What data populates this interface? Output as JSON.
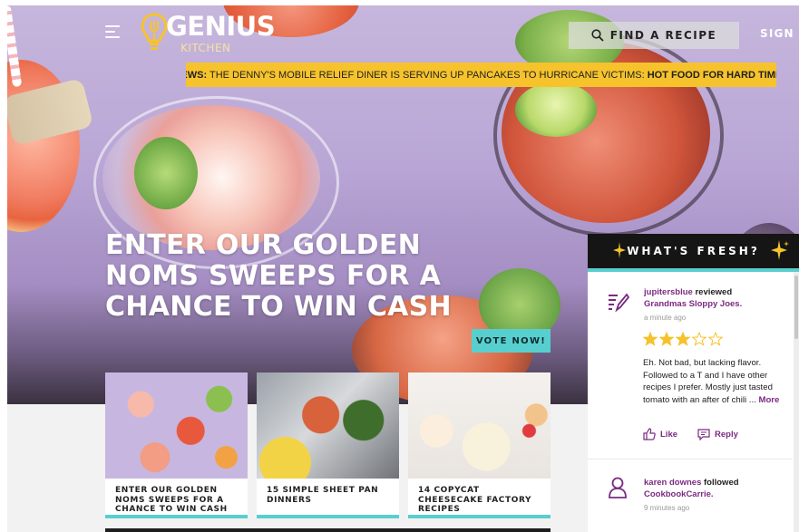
{
  "header": {
    "logo_top": "GENIUS",
    "logo_bottom": "KITCHEN",
    "find_label": "FIND A RECIPE",
    "sign_in": "SIGN IN"
  },
  "news": {
    "label": "NEWS:",
    "text": " THE DENNY'S MOBILE RELIEF DINER IS SERVING UP PANCAKES TO HURRICANE VICTIMS: ",
    "highlight": "HOT FOOD FOR HARD TIMES"
  },
  "hero": {
    "headline": "ENTER OUR GOLDEN NOMS SWEEPS FOR A CHANCE TO WIN CASH",
    "cta": "VOTE NOW!"
  },
  "cards": [
    {
      "title": "ENTER OUR GOLDEN NOMS SWEEPS FOR A CHANCE TO WIN CASH"
    },
    {
      "title": "15 SIMPLE SHEET PAN DINNERS"
    },
    {
      "title": "14 COPYCAT CHEESECAKE FACTORY RECIPES"
    }
  ],
  "sidebar": {
    "title": "WHAT'S FRESH?",
    "items": [
      {
        "user": "jupitersblue",
        "action": "reviewed",
        "target": "Grandmas Sloppy Joes.",
        "time": "a minute ago",
        "rating": 3,
        "max_rating": 5,
        "review": "Eh. Not bad, but lacking flavor. Followed to a T and I have other recipes I prefer. Mostly just tasted tomato with an after of chili ...",
        "more": "More",
        "like": "Like",
        "reply": "Reply"
      },
      {
        "user": "karen downes",
        "action": "followed",
        "target": "CookbookCarrie.",
        "time": "9 minutes ago"
      }
    ]
  },
  "colors": {
    "news_bg": "#f7c32c",
    "accent_teal": "#58cfcf",
    "link_purple": "#7a2a82",
    "star_gold": "#f6c12a"
  }
}
